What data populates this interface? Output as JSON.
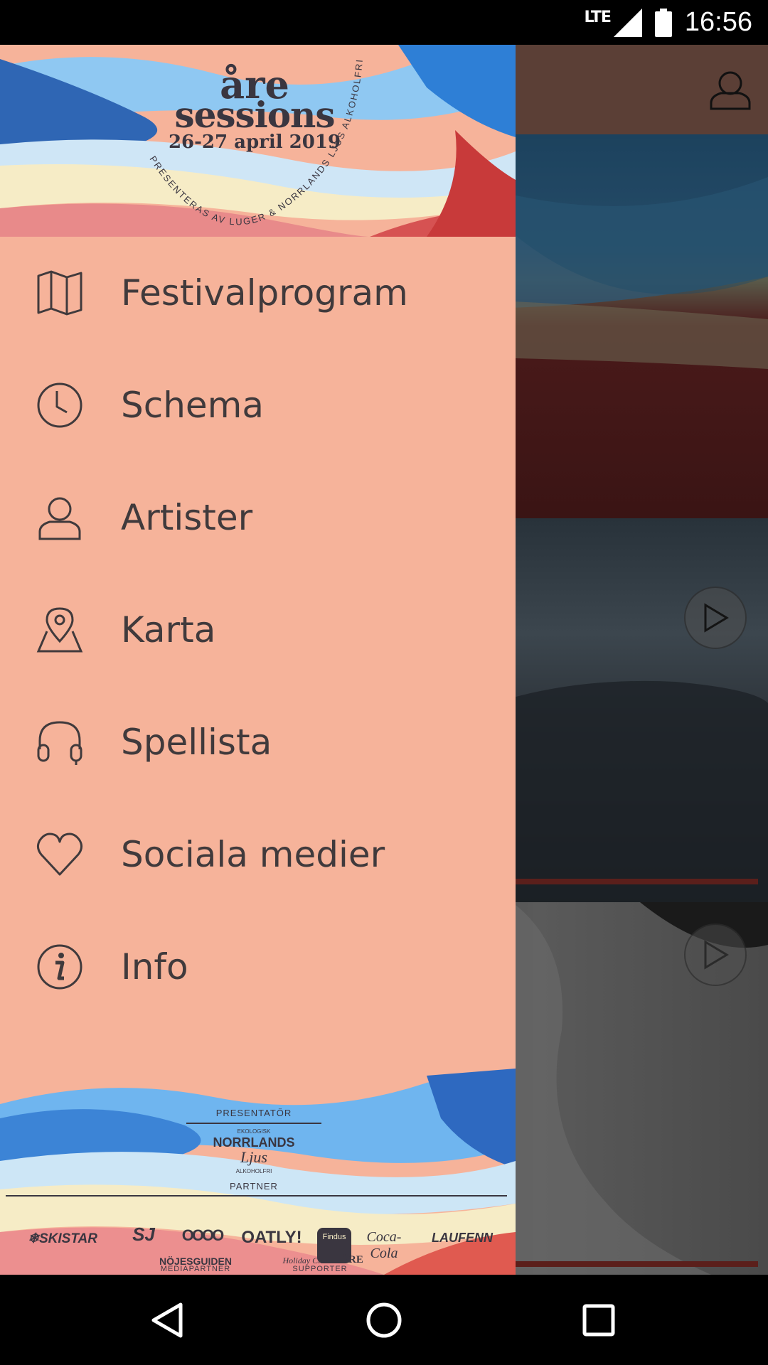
{
  "status_bar": {
    "network": "LTE",
    "time": "16:56"
  },
  "drawer": {
    "header": {
      "logo_line1": "åre",
      "logo_line2": "sessions",
      "logo_dates": "26-27 april 2019",
      "logo_arc_text": "PRESENTERAS AV LUGER & NORRLANDS LJUS ALKOHOLFRI"
    },
    "menu": [
      {
        "label": "Festivalprogram",
        "icon": "map-icon"
      },
      {
        "label": "Schema",
        "icon": "clock-icon"
      },
      {
        "label": "Artister",
        "icon": "person-icon"
      },
      {
        "label": "Karta",
        "icon": "location-pin-icon"
      },
      {
        "label": "Spellista",
        "icon": "headphones-icon"
      },
      {
        "label": "Sociala medier",
        "icon": "heart-icon"
      },
      {
        "label": "Info",
        "icon": "info-icon"
      }
    ],
    "footer": {
      "presentator_label": "PRESENTATÖR",
      "presentator_small_top": "EKOLOGISK",
      "presentator_logo": "NORRLANDS",
      "presentator_logo_sub": "Ljus",
      "presentator_small_bottom": "ALKOHOLFRI",
      "partner_label": "PARTNER",
      "partners": [
        "❄SKISTAR",
        "SJ",
        "OOOO",
        "OATLY!",
        "Findus",
        "Coca-Cola",
        "LAUFENN"
      ],
      "mediapartner_label": "MEDIAPARTNER",
      "supporter_label": "SUPPORTER",
      "mediapartner": "NÖJESGUIDEN",
      "supporters": [
        "Holiday Club",
        "ÅRE"
      ]
    }
  },
  "colors": {
    "drawer_bg": "#f6b39a",
    "text": "#403a3c",
    "topbar": "#5b3f36"
  }
}
